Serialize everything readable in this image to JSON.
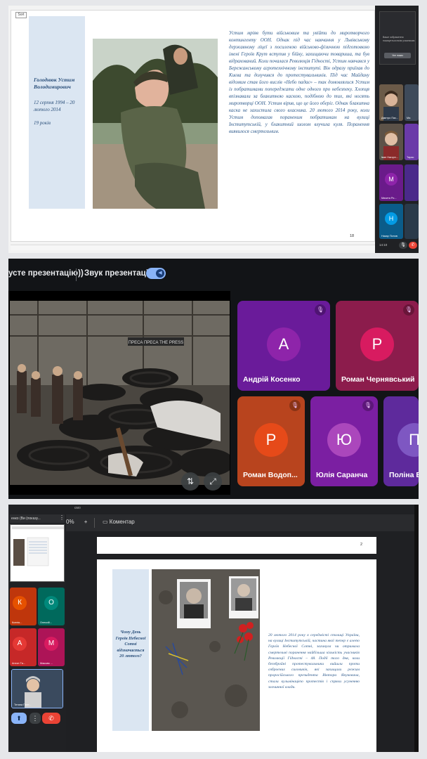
{
  "panel1": {
    "slide_tag": "Sort",
    "name": "Голоднюк Устим Володимирович",
    "dates": "12 серпня 1994 – 20 лютого 2014",
    "age": "19 років",
    "story": "Устим мріяв бути військовим та увійти до миротворчого контингенту ООН. Однак під час навчання у Львівському державному ліцеї з посиленою військово-фізичною підготовкою імені Героїв Крут вступив у бійку, захищаючи товариша, та був відрахований. Коли почалася Революція Гідності, Устим навчався у Бережанському агротехнічному інституті. Він одразу приїхав до Києва та долучився до протестувальників. Під час Майдану відомим став його вислів «Небо падає» – так домовлялися Устим із побратимами попереджати одне одного про небезпеку. Хлопця впізнавали за блакитною каскою, подібною до тих, які носять миротворці ООН. Устим вірив, що це його оберіг. Однак блакитна каска не захистила свого власника. 20 лютого 2014 року, коли Устим допомагав пораненим побратимам на вулиці Інститутській, у блакитний шолом влучила куля. Поранення виявилося смертельним.",
    "page_number": "18",
    "side_thumb_text": "Ваше зображення показується всім учасникам",
    "side_thumb_button": "Усе показ",
    "tiles": [
      {
        "name": "Дмитро Пас...",
        "kind": "photo"
      },
      {
        "name": "Ма",
        "kind": "photo"
      },
      {
        "name": "Іван Нагорн...",
        "kind": "photo"
      },
      {
        "name": "Тарас",
        "kind": "photo"
      },
      {
        "name": "Микита Ро...",
        "letter": "М",
        "color": "#8e24aa"
      },
      {
        "name": "Назар Попов",
        "letter": "Н",
        "color": "#039be5"
      }
    ],
    "time": "14:10"
  },
  "panel2": {
    "stop_label": "усте презентацію))",
    "sound_label": "Звук презентації",
    "participants": [
      {
        "name": "Андрій Косенко",
        "letter": "А",
        "bg": "#6a1b9a",
        "ava": "#8e24aa"
      },
      {
        "name": "Роман Чернявський",
        "letter": "Р",
        "bg": "#8c1c4c",
        "ava": "#d81b60"
      },
      {
        "name": "Роман Водоп...",
        "letter": "Р",
        "bg": "#b8441e",
        "ava": "#e64a19"
      },
      {
        "name": "Юлія Саранча",
        "letter": "Ю",
        "bg": "#7b1fa2",
        "ava": "#ab47bc"
      },
      {
        "name": "Поліна В",
        "letter": "П",
        "bg": "#5e2a9c",
        "ava": "#7e57c2"
      }
    ]
  },
  "panel3": {
    "left_header": "енко (Ви (показу...",
    "zoom_label": "0%",
    "comment_label": "Коментар",
    "top_label": "ємо",
    "page_number": "2",
    "question": "Чому День Героїв Небесної Сотні відзначається 20 лютого?",
    "text": "20 лютого 2014 року в середмісті столиці України, на вулиці Інститутській, частина якої тепер є алеєю Героїв Небесної Сотні, загинула чи отримала смертельні поранення найбільша кількість учасників Революції Гідності – 48. Події того дня, коли беззбройні протестувальники вийшли проти озброєних силовиків, які захищали режим проросійського президента Віктора Януковича, стали кульмінацією протестів і спряли усуненню злочинної влади.",
    "tiles": [
      {
        "name": "Ксенія...",
        "letter": "К",
        "color": "#e65100",
        "bg": "#bf360c"
      },
      {
        "name": "Олексій...",
        "letter": "О",
        "color": "#00897b",
        "bg": "#00695c"
      },
      {
        "name": "Антон Та...",
        "letter": "А",
        "color": "#e53935",
        "bg": "#c62828"
      },
      {
        "name": "Максим ...",
        "letter": "М",
        "color": "#d81b60",
        "bg": "#ad1457"
      }
    ],
    "self_name": "Тетяна Попт..."
  }
}
